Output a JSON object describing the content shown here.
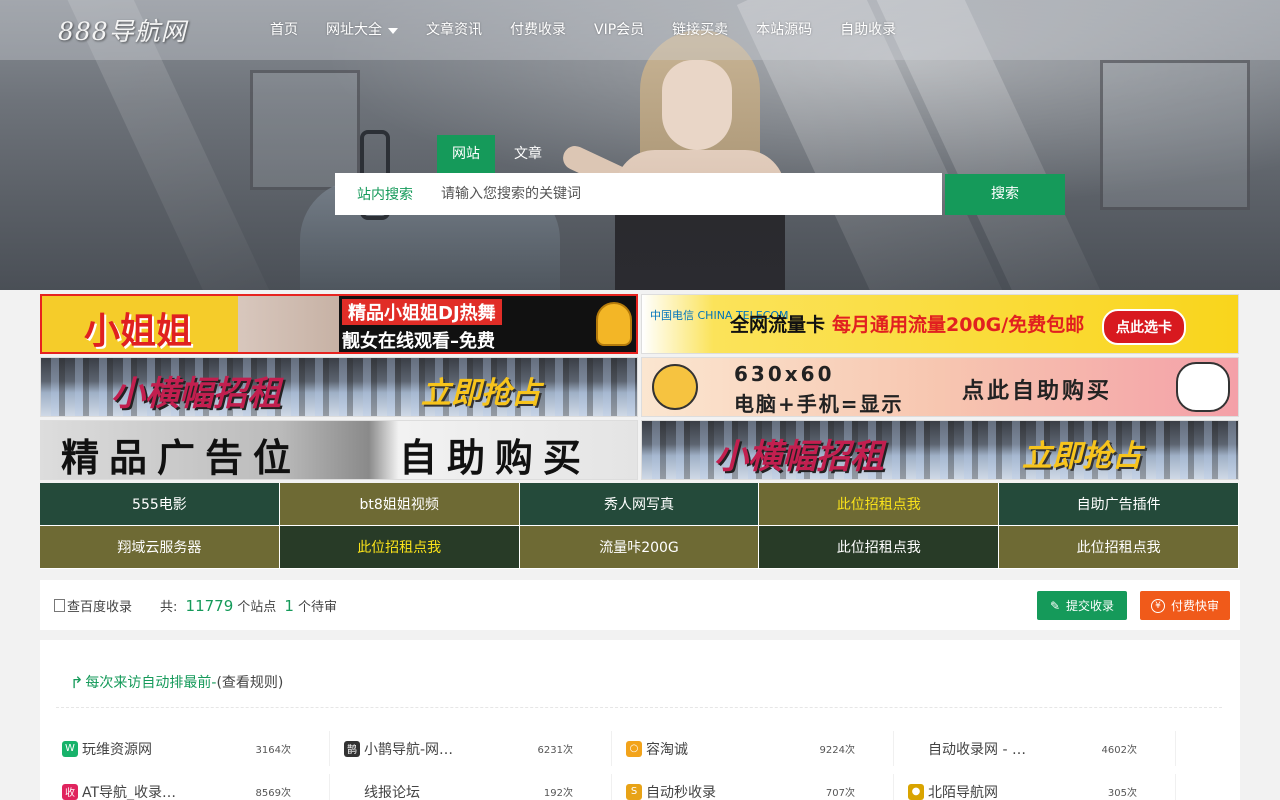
{
  "logo": "888导航网",
  "nav": {
    "items": [
      {
        "label": "首页",
        "dropdown": false
      },
      {
        "label": "网址大全",
        "dropdown": true
      },
      {
        "label": "文章资讯",
        "dropdown": false
      },
      {
        "label": "付费收录",
        "dropdown": false
      },
      {
        "label": "VIP会员",
        "dropdown": false
      },
      {
        "label": "链接买卖",
        "dropdown": false
      },
      {
        "label": "本站源码",
        "dropdown": false
      },
      {
        "label": "自助收录",
        "dropdown": false
      }
    ]
  },
  "search": {
    "tabs": [
      "网站",
      "文章"
    ],
    "active_tab": "网站",
    "scope": "站内搜索",
    "placeholder": "请输入您搜索的关键词",
    "button": "搜索"
  },
  "banners": {
    "ad1": {
      "title": "小姐姐",
      "line1": "精品小姐姐DJ热舞",
      "line2": "靓女在线观看–免费"
    },
    "ad2": {
      "brand": "中国电信 CHINA TELECOM",
      "text1": "全网流量卡",
      "text2": "每月通用流量200G/免费包邮",
      "button": "点此选卡"
    },
    "ad3": {
      "text1": "小横幅招租",
      "text2": "立即抢占"
    },
    "ad4": {
      "line1": "630x60",
      "line2": "电脑+手机=显示",
      "text": "点此自助购买"
    },
    "ad5": {
      "text1": "精品广告位",
      "text2": "自助购买"
    },
    "ad6": {
      "text1": "小横幅招租",
      "text2": "立即抢占"
    }
  },
  "text_ads": [
    {
      "label": "555电影",
      "bg": "#244a3a",
      "highlight": false
    },
    {
      "label": "bt8姐姐视频",
      "bg": "#6e6a34",
      "highlight": false
    },
    {
      "label": "秀人网写真",
      "bg": "#244a3a",
      "highlight": false
    },
    {
      "label": "此位招租点我",
      "bg": "#6e6a34",
      "highlight": true
    },
    {
      "label": "自助广告插件",
      "bg": "#244a3a",
      "highlight": false
    },
    {
      "label": "翔域云服务器",
      "bg": "#6e6a34",
      "highlight": false
    },
    {
      "label": "此位招租点我",
      "bg": "#283b27",
      "highlight": true
    },
    {
      "label": "流量咔200G",
      "bg": "#6e6a34",
      "highlight": false
    },
    {
      "label": "此位招租点我",
      "bg": "#283b27",
      "highlight": false
    },
    {
      "label": "此位招租点我",
      "bg": "#6e6a34",
      "highlight": false
    }
  ],
  "stats": {
    "baidu_label": "查百度收录",
    "prefix": "共:",
    "site_count": "11779",
    "site_unit": "个站点",
    "pending_count": "1",
    "pending_unit": "个待审",
    "submit_button": "提交收录",
    "paid_button": "付费快审"
  },
  "panel": {
    "title": "每次来访自动排最前-",
    "rule_link": "(查看规则)"
  },
  "sites": [
    {
      "name": "玩维资源网",
      "hits": "3164次",
      "icon": "w-icon",
      "icon_color": "#17b26a",
      "icon_glyph": "W"
    },
    {
      "name": "小鹊导航-网…",
      "hits": "6231次",
      "icon": "magpie-icon",
      "icon_color": "#333333",
      "icon_glyph": "鹊"
    },
    {
      "name": "容淘诚",
      "hits": "9224次",
      "icon": "ring-icon",
      "icon_color": "#f2a31b",
      "icon_glyph": "○"
    },
    {
      "name": "自动收录网 - …",
      "hits": "4602次",
      "icon": "",
      "icon_color": "",
      "icon_glyph": ""
    },
    {
      "name": "AT导航_收录…",
      "hits": "8569次",
      "icon": "shou-icon",
      "icon_color": "#e0245e",
      "icon_glyph": "收"
    },
    {
      "name": "线报论坛",
      "hits": "192次",
      "icon": "",
      "icon_color": "",
      "icon_glyph": ""
    },
    {
      "name": "自动秒收录",
      "hits": "707次",
      "icon": "s-icon",
      "icon_color": "#e8a317",
      "icon_glyph": "S"
    },
    {
      "name": "北陌导航网",
      "hits": "305次",
      "icon": "circle-logo-icon",
      "icon_color": "#d9a400",
      "icon_glyph": "●"
    }
  ]
}
